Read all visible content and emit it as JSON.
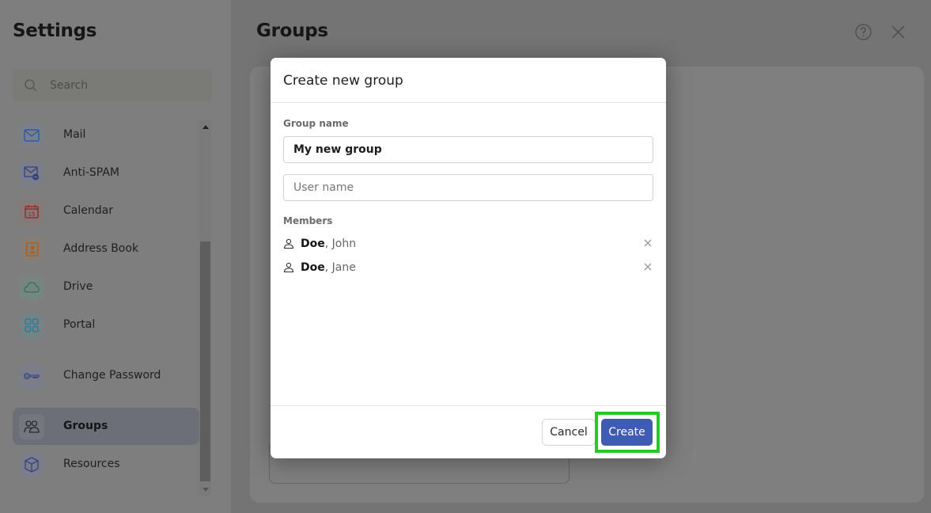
{
  "sidebar": {
    "title": "Settings",
    "search": {
      "placeholder": "Search",
      "icon": "search-icon"
    },
    "items": [
      {
        "label": "Mail",
        "icon": "mail-icon",
        "color": "#2c5aa8",
        "bg": "#7b8088"
      },
      {
        "label": "Anti-SPAM",
        "icon": "anti-spam-icon",
        "color": "#343f8a",
        "bg": "#7b7e88"
      },
      {
        "label": "Calendar",
        "icon": "calendar-icon",
        "color": "#9a2020",
        "bg": "#857a7a",
        "day": "15"
      },
      {
        "label": "Address Book",
        "icon": "address-book-icon",
        "color": "#b55d12",
        "bg": "#857e78"
      },
      {
        "label": "Drive",
        "icon": "cloud-icon",
        "color": "#227a5e",
        "bg": "#778480"
      },
      {
        "label": "Portal",
        "icon": "grid-icon",
        "color": "#1f7e9a",
        "bg": "#778286"
      },
      {
        "label": "Change Password",
        "icon": "key-icon",
        "color": "#343f8a",
        "bg": "#7b7e88"
      },
      {
        "label": "Groups",
        "icon": "groups-icon",
        "color": "#2a2a2a",
        "bg": "#747780",
        "active": true
      },
      {
        "label": "Resources",
        "icon": "cube-icon",
        "color": "#343f8a",
        "bg": "#7b7e88"
      }
    ]
  },
  "main": {
    "title": "Groups",
    "help_icon": "help-icon",
    "close_icon": "close-icon"
  },
  "dialog": {
    "title": "Create new group",
    "group_name_label": "Group name",
    "group_name_value": "My new group",
    "user_name_placeholder": "User name",
    "members_label": "Members",
    "members": [
      {
        "last": "Doe",
        "first": "John"
      },
      {
        "last": "Doe",
        "first": "Jane"
      }
    ],
    "cancel_label": "Cancel",
    "create_label": "Create",
    "primary_color": "#3f5cb5",
    "highlight_color": "#22cc22"
  }
}
